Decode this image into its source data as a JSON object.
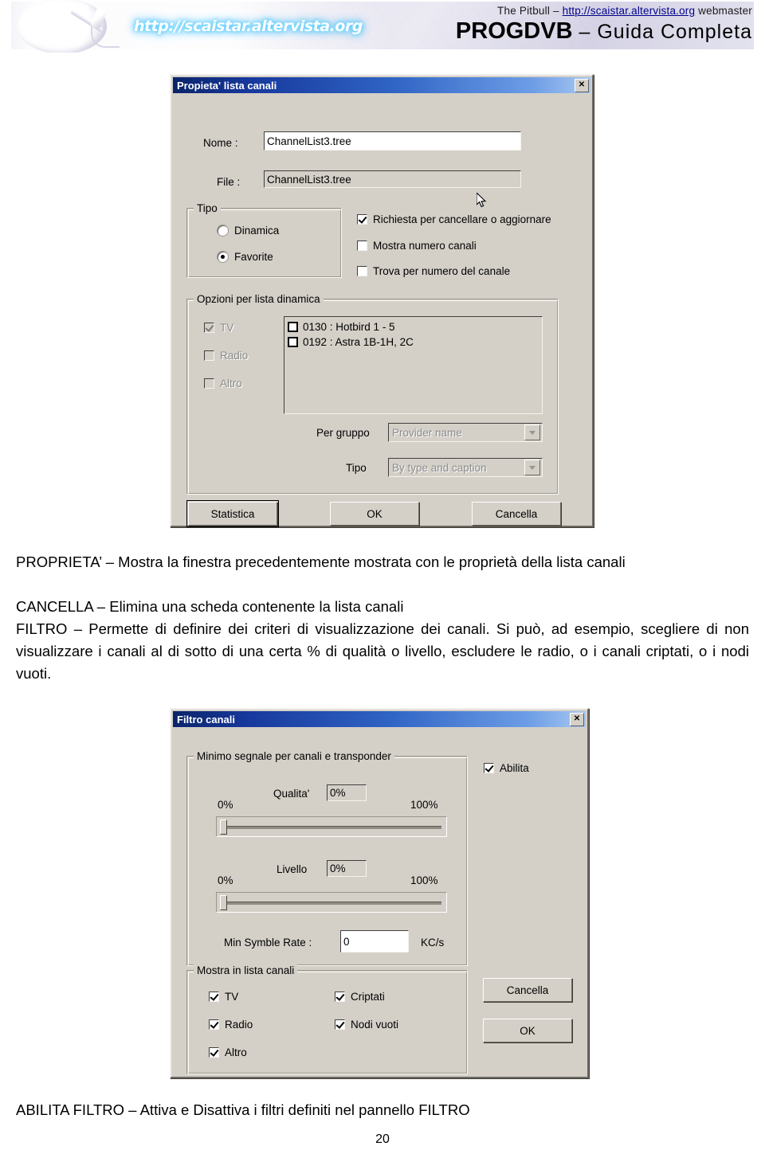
{
  "header": {
    "logo_url_neon": "http://scaistar.altervista.org",
    "byline_prefix": "The Pitbull – ",
    "byline_link": "http://scaistar.altervista.org",
    "byline_suffix": " webmaster",
    "title_strong": "PROGDVB",
    "title_rest": " – Guida Completa"
  },
  "dialog1": {
    "title": "Propieta' lista canali",
    "close_label": "✕",
    "name_label": "Nome :",
    "name_value": "ChannelList3.tree",
    "file_label": "File :",
    "file_value": "ChannelList3.tree",
    "tipo_group": "Tipo",
    "radios": [
      {
        "label": "Dinamica",
        "checked": false
      },
      {
        "label": "Favorite",
        "checked": true
      }
    ],
    "checks": [
      {
        "label": "Richiesta per cancellare o aggiornare",
        "checked": true
      },
      {
        "label": "Mostra numero canali",
        "checked": false
      },
      {
        "label": "Trova per numero del canale",
        "checked": false
      }
    ],
    "dyn_group": "Opzioni per lista dinamica",
    "dyn_checks": [
      {
        "label": "TV",
        "checked": true,
        "disabled": true
      },
      {
        "label": "Radio",
        "checked": false,
        "disabled": true
      },
      {
        "label": "Altro",
        "checked": false,
        "disabled": true
      }
    ],
    "list_items": [
      {
        "label": "0130 : Hotbird 1 - 5",
        "checked": false
      },
      {
        "label": "0192 : Astra 1B-1H, 2C",
        "checked": false
      }
    ],
    "per_gruppo_label": "Per gruppo",
    "per_gruppo_value": "Provider name",
    "tipo_combo_label": "Tipo",
    "tipo_combo_value": "By type and caption",
    "buttons": {
      "statistica": "Statistica",
      "ok": "OK",
      "cancella": "Cancella"
    }
  },
  "body_text": {
    "line1": "PROPRIETA’ – Mostra la finestra precedentemente mostrata con le proprietà della lista canali",
    "line2": "CANCELLA – Elimina una scheda contenente la lista canali",
    "line3": "FILTRO – Permette di definire dei criteri di visualizzazione dei canali. Si può, ad esempio, scegliere di non visualizzare i canali al di sotto di una certa % di qualità o livello, escludere le radio, o i canali criptati, o i nodi vuoti."
  },
  "dialog2": {
    "title": "Filtro canali",
    "close_label": "✕",
    "signal_group": "Minimo segnale per canali e transponder",
    "abilita": {
      "label": "Abilita",
      "checked": true
    },
    "quality": {
      "label": "Qualita'",
      "value": "0%",
      "min_label": "0%",
      "max_label": "100%",
      "position_pct": 0
    },
    "level": {
      "label": "Livello",
      "value": "0%",
      "min_label": "0%",
      "max_label": "100%",
      "position_pct": 0
    },
    "symbol_rate": {
      "label": "Min Symble Rate :",
      "value": "0",
      "unit": "KC/s"
    },
    "show_group": "Mostra in lista canali",
    "show_checks_left": [
      {
        "label": "TV",
        "checked": true
      },
      {
        "label": "Radio",
        "checked": true
      },
      {
        "label": "Altro",
        "checked": true
      }
    ],
    "show_checks_right": [
      {
        "label": "Criptati",
        "checked": true
      },
      {
        "label": "Nodi vuoti",
        "checked": true
      }
    ],
    "buttons": {
      "cancella": "Cancella",
      "ok": "OK"
    }
  },
  "footer": {
    "abilita_filtro_line": "ABILITA FILTRO – Attiva e Disattiva i filtri definiti nel pannello FILTRO",
    "page_number": "20"
  }
}
